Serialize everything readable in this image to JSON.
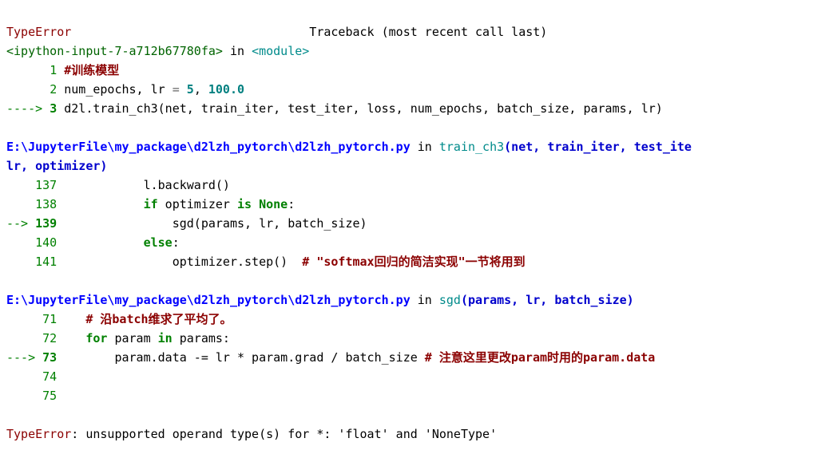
{
  "header": {
    "error_name": "TypeError",
    "traceback_label": "Traceback (most recent call last)"
  },
  "frame1": {
    "location_open": "<ipython-input-7-a712b67780fa>",
    "location_in": " in ",
    "module": "<module>",
    "lines": [
      {
        "no": "1",
        "arrow": "      ",
        "content_comment": "#训练模型"
      },
      {
        "no": "2",
        "arrow": "      ",
        "content_plain": "num_epochs, lr ",
        "content_op": "= ",
        "content_num1": "5",
        "content_sep": ", ",
        "content_num2": "100.0"
      },
      {
        "no": "3",
        "arrow": "----> ",
        "content_plain": "d2l.train_ch3(net, train_iter, test_iter, loss, num_epochs, batch_size, params, lr)"
      }
    ]
  },
  "frame2": {
    "path": "E:\\JupyterFile\\my_package\\d2lzh_pytorch\\d2lzh_pytorch.py",
    "in": " in ",
    "func": "train_ch3",
    "sig_open": "(net, train_iter, test_ite",
    "sig_cont": "lr, optimizer)",
    "lines": [
      {
        "no": "137",
        "arrow": "    ",
        "indent": "            ",
        "content": "l.backward()"
      },
      {
        "no": "138",
        "arrow": "    ",
        "indent": "            ",
        "content_kw": "if",
        "content_mid": " optimizer ",
        "content_kw2": "is",
        "content_mid2": " ",
        "content_bool": "None",
        "content_mid3": ":"
      },
      {
        "no": "139",
        "arrow": "--> ",
        "indent": "                ",
        "content": "sgd(params, lr, batch_size)"
      },
      {
        "no": "140",
        "arrow": "    ",
        "indent": "            ",
        "content_kw": "else",
        "content": ":"
      },
      {
        "no": "141",
        "arrow": "    ",
        "indent": "                ",
        "content": "optimizer.step()  ",
        "comment": "# \"softmax回归的简洁实现\"一节将用到"
      }
    ]
  },
  "frame3": {
    "path": "E:\\JupyterFile\\my_package\\d2lzh_pytorch\\d2lzh_pytorch.py",
    "in": " in ",
    "func": "sgd",
    "sig": "(params, lr, batch_size)",
    "lines": [
      {
        "no": "71",
        "arrow": "     ",
        "indent": "    ",
        "comment": "# 沿batch维求了平均了。"
      },
      {
        "no": "72",
        "arrow": "     ",
        "indent": "    ",
        "content_kw": "for",
        "content_mid": " param ",
        "content_kw2": "in",
        "content_mid2": " params:"
      },
      {
        "no": "73",
        "arrow": "---> ",
        "indent": "        ",
        "content": "param.data -= lr * param.grad / batch_size ",
        "comment": "# 注意这里更改param时用的param.data"
      },
      {
        "no": "74",
        "arrow": "     ",
        "indent": "",
        "content": ""
      },
      {
        "no": "75",
        "arrow": "     ",
        "indent": "",
        "content": ""
      }
    ]
  },
  "final": {
    "error_name": "TypeError",
    "message": ": unsupported operand type(s) for *: 'float' and 'NoneType'"
  }
}
